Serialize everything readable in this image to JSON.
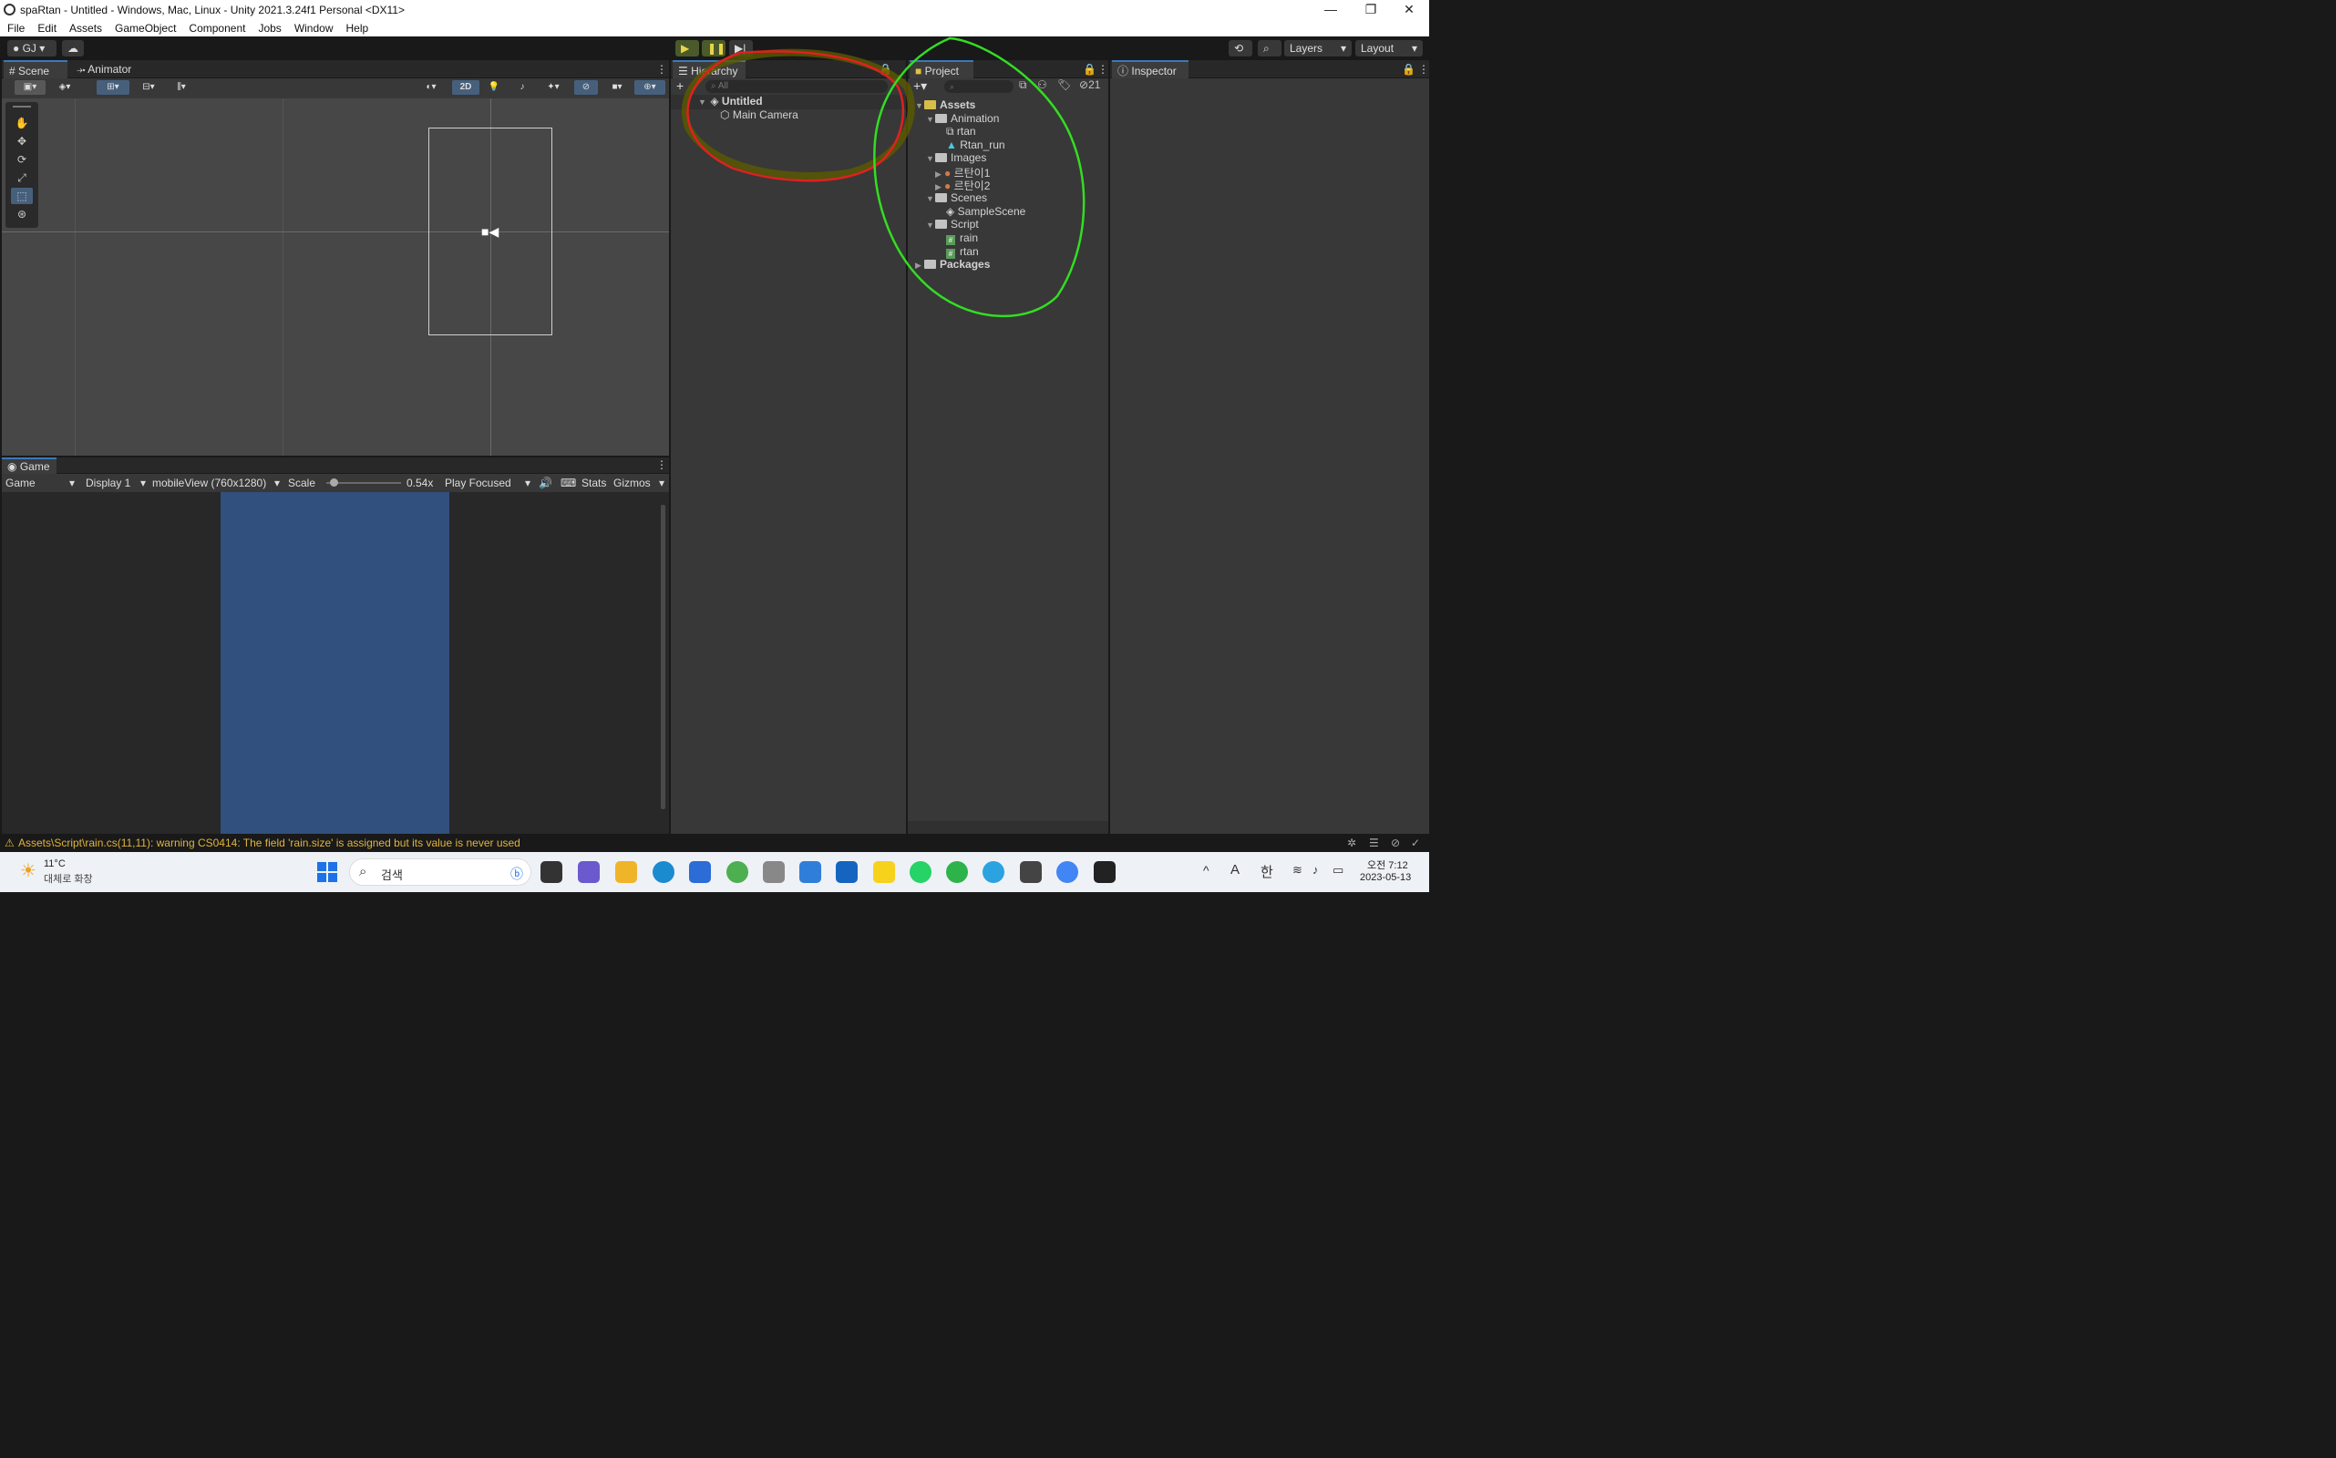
{
  "window": {
    "title": "spaRtan - Untitled - Windows, Mac, Linux - Unity 2021.3.24f1 Personal <DX11>",
    "controls": [
      "—",
      "❐",
      "✕"
    ]
  },
  "menu": [
    "File",
    "Edit",
    "Assets",
    "GameObject",
    "Component",
    "Jobs",
    "Window",
    "Help"
  ],
  "toolbar": {
    "account": "GJ",
    "layers": "Layers",
    "layout": "Layout"
  },
  "scene": {
    "tabs": [
      "Scene",
      "Animator"
    ],
    "mode_2d": "2D"
  },
  "game": {
    "tab": "Game",
    "display_mode": "Game",
    "display": "Display 1",
    "resolution": "mobileView (760x1280)",
    "scale_label": "Scale",
    "scale_value": "0.54x",
    "scale_fraction": 0.05,
    "play_mode": "Play Focused",
    "stats": "Stats",
    "gizmos": "Gizmos",
    "camera_color": "#31507d"
  },
  "hierarchy": {
    "tab": "Hierarchy",
    "search_placeholder": "All",
    "scene": "Untitled",
    "items": [
      "Main Camera"
    ]
  },
  "project": {
    "tab": "Project",
    "count": "21",
    "root": "Assets",
    "animation": "Animation",
    "anim_items": [
      "rtan",
      "Rtan_run"
    ],
    "images": "Images",
    "image_items": [
      "르탄이1",
      "르탄이2"
    ],
    "scenes": "Scenes",
    "scene_items": [
      "SampleScene"
    ],
    "script": "Script",
    "script_items": [
      "rain",
      "rtan"
    ],
    "packages": "Packages"
  },
  "inspector": {
    "tab": "Inspector"
  },
  "status": {
    "message": "Assets\\Script\\rain.cs(11,11): warning CS0414: The field 'rain.size' is assigned but its value is never used"
  },
  "taskbar": {
    "weather_temp": "11°C",
    "weather_desc": "대체로 화창",
    "search_placeholder": "검색",
    "ime_a": "A",
    "ime_han": "한",
    "time": "오전 7:12",
    "date": "2023-05-13"
  },
  "annotations": {
    "red_color": "#e02020",
    "green_color": "#33dd22",
    "yellow_color": "#5a5a00"
  }
}
